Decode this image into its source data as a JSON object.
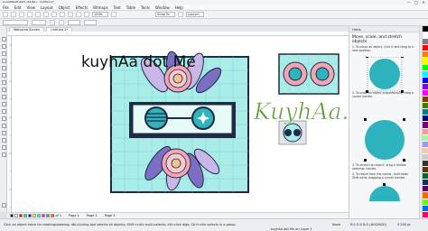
{
  "window": {
    "title": "CorelDRAW 2021 (64-Bit) - Untitled-1*",
    "controls": [
      "—",
      "□",
      "✕"
    ]
  },
  "menu": {
    "items": [
      "File",
      "Edit",
      "View",
      "Layout",
      "Object",
      "Effects",
      "Bitmaps",
      "Text",
      "Table",
      "Tools",
      "Window",
      "Help"
    ]
  },
  "toolbar": {
    "zoom_value": "100%",
    "snap_to_label": "Snap To",
    "launch_label": "Launch"
  },
  "tabs": {
    "welcome": "Welcome Screen",
    "document": "Untitled-1*"
  },
  "watermark": {
    "text": "kuyhAa dot Me",
    "script_logo": "KuyhAa.Me"
  },
  "docker": {
    "header": "Hints",
    "title": "Move, scale, and stretch objects",
    "intro": "1. To move an object, click it and drag to a new position.",
    "step_b": "2. To scale an object proportionally, drag a corner handle.",
    "step_c": "3. To stretch an object, drag a middle selection handle.",
    "step_d": "4. To resize from the center, hold down Shift while dragging a corner handle."
  },
  "pages": {
    "nav": "1 of 1",
    "page1": "Page 1",
    "page2": "Page 2",
    "page3": "Page 3"
  },
  "status": {
    "hint": "Click an object twice for rotating/skewing; dbl-clicking tool selects all objects; Shift+click multi-selects; Alt+click digs; Ctrl+click selects in a group",
    "object_info": "kuyhAa dot Me on Layer 1",
    "fill_label": "None",
    "color_info": "R:0 G:0 B:0 (#000000)",
    "outline": "0.500 pt"
  },
  "colors": {
    "bg_teal": "#a9ece8",
    "grid_line": "#7ad8d2",
    "dark_navy": "#1f2a44",
    "petal_pink": "#f3a5b4",
    "petal_lavender": "#c9b7e8",
    "leaf_purple": "#7b6fc4",
    "lens_teal": "#2fb3bd",
    "accent_green": "#5c9c36",
    "circle_teal": "#2cb3bd"
  },
  "palette": [
    "#000000",
    "#ffffff",
    "#7f7f7f",
    "#ff0000",
    "#ff7f00",
    "#ffff00",
    "#00ff00",
    "#00ffff",
    "#0000ff",
    "#7f00ff",
    "#ff00ff",
    "#7f3f00",
    "#3f7f00",
    "#007f7f",
    "#00007f",
    "#7f007f",
    "#ff9999",
    "#99ff99",
    "#9999ff",
    "#ffcc99",
    "#cccccc",
    "#333333",
    "#663300",
    "#006633",
    "#003366",
    "#660066",
    "#ff6600",
    "#66ff00",
    "#0066ff",
    "#ff0066"
  ],
  "bottom_swatches": [
    "#000000",
    "#ffffff",
    "#ff0000",
    "#00ff00",
    "#0000ff",
    "#ffff00",
    "#00ffff",
    "#ff00ff",
    "#7f7f7f",
    "#ff7f00"
  ]
}
